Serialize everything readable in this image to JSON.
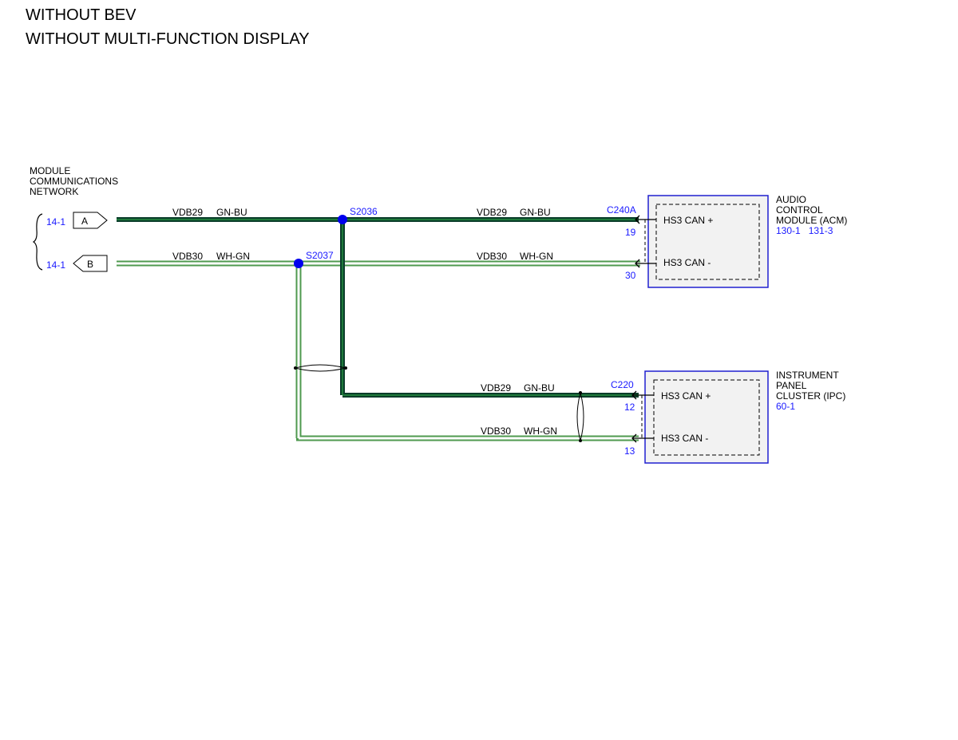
{
  "header": {
    "line1": "WITHOUT BEV",
    "line2": "WITHOUT MULTI-FUNCTION DISPLAY"
  },
  "network": {
    "title_lines": [
      "MODULE",
      "COMMUNICATIONS",
      "NETWORK"
    ],
    "connectors": [
      {
        "ref": "14-1",
        "letter": "A"
      },
      {
        "ref": "14-1",
        "letter": "B"
      }
    ]
  },
  "splices": {
    "s2036": "S2036",
    "s2037": "S2037"
  },
  "wires": {
    "vdb29_left": {
      "circuit": "VDB29",
      "color": "GN-BU"
    },
    "vdb30_left": {
      "circuit": "VDB30",
      "color": "WH-GN"
    },
    "vdb29_acm": {
      "circuit": "VDB29",
      "color": "GN-BU"
    },
    "vdb30_acm": {
      "circuit": "VDB30",
      "color": "WH-GN"
    },
    "vdb29_ipc": {
      "circuit": "VDB29",
      "color": "GN-BU"
    },
    "vdb30_ipc": {
      "circuit": "VDB30",
      "color": "WH-GN"
    }
  },
  "modules": {
    "acm": {
      "connector": "C240A",
      "name_lines": [
        "AUDIO",
        "CONTROL",
        "MODULE (ACM)"
      ],
      "refs": "130-1   131-3",
      "pins": [
        {
          "number": "19",
          "label": "HS3 CAN +"
        },
        {
          "number": "30",
          "label": "HS3 CAN -"
        }
      ]
    },
    "ipc": {
      "connector": "C220",
      "name_lines": [
        "INSTRUMENT",
        "PANEL",
        "CLUSTER (IPC)"
      ],
      "refs": "60-1",
      "pins": [
        {
          "number": "12",
          "label": "HS3 CAN +"
        },
        {
          "number": "13",
          "label": "HS3 CAN -"
        }
      ]
    }
  },
  "colors": {
    "gn_bu_outer": "#0a3d2a",
    "gn_bu_inner": "#1f7a3a",
    "wh_gn_stripe": "#4f9a4f",
    "reference_blue": "#1a1aff",
    "splice_dot": "#0000ee",
    "module_border": "#2020d0",
    "module_fill": "#f2f2f2"
  }
}
